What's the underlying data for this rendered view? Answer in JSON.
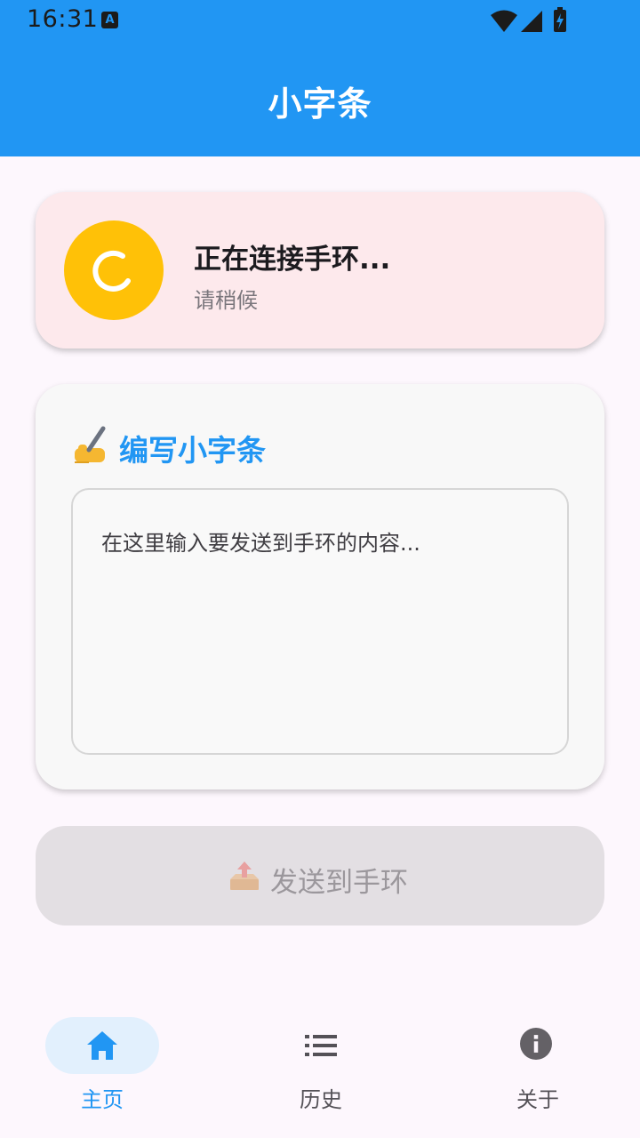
{
  "status_bar": {
    "time": "16:31",
    "notification_icon": "text-input-icon",
    "icons": [
      "wifi-icon",
      "signal-icon",
      "battery-charging-icon"
    ]
  },
  "app_bar": {
    "title": "小字条"
  },
  "connection": {
    "title": "正在连接手环...",
    "subtitle": "请稍候",
    "icon": "loading-spinner-icon",
    "color": "#ffc107"
  },
  "compose": {
    "emoji": "writing-hand-icon",
    "title": "编写小字条",
    "placeholder": "在这里输入要发送到手环的内容..."
  },
  "send_button": {
    "icon": "outbox-tray-icon",
    "label": "发送到手环",
    "enabled": false
  },
  "bottom_nav": {
    "items": [
      {
        "label": "主页",
        "icon": "home-icon",
        "active": true
      },
      {
        "label": "历史",
        "icon": "list-icon",
        "active": false
      },
      {
        "label": "关于",
        "icon": "info-icon",
        "active": false
      }
    ]
  },
  "colors": {
    "primary": "#2196f3",
    "connection_card": "#fde9ec",
    "background": "#fdf7fd"
  }
}
